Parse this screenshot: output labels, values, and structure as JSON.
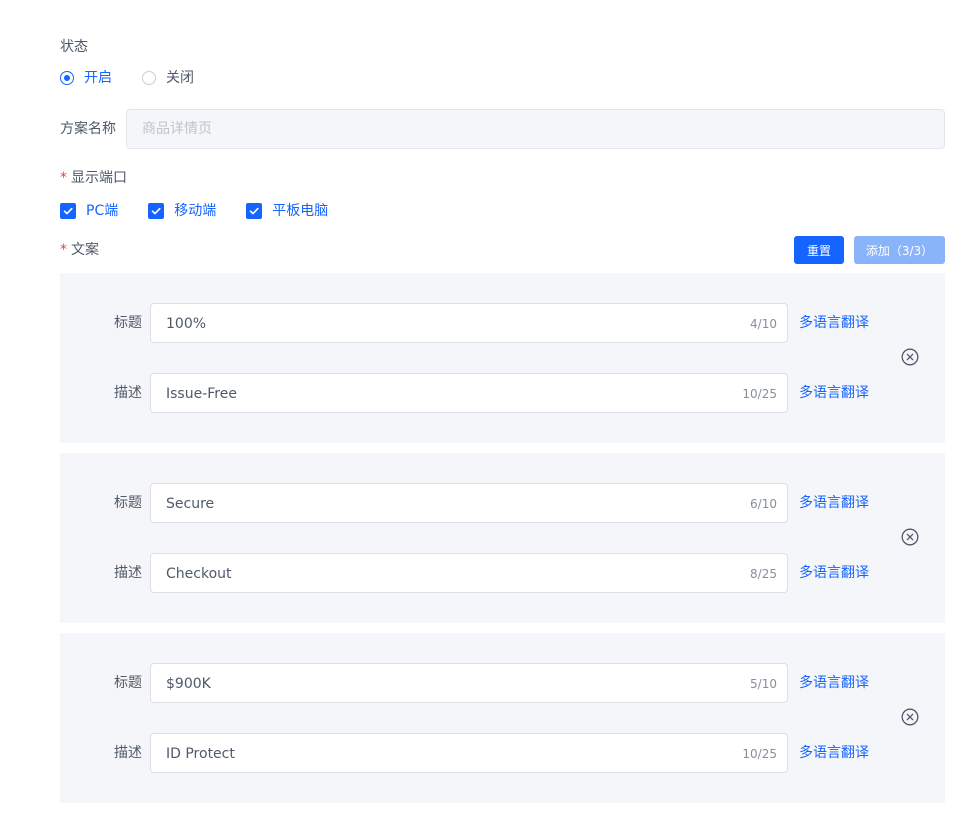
{
  "status": {
    "label": "状态",
    "options": [
      {
        "label": "开启",
        "checked": true
      },
      {
        "label": "关闭",
        "checked": false
      }
    ]
  },
  "plan_name": {
    "label": "方案名称",
    "placeholder": "商品详情页"
  },
  "ports": {
    "required_mark": "*",
    "label": "显示端口",
    "options": [
      {
        "label": "PC端",
        "checked": true
      },
      {
        "label": "移动端",
        "checked": true
      },
      {
        "label": "平板电脑",
        "checked": true
      }
    ]
  },
  "copy": {
    "required_mark": "*",
    "label": "文案",
    "reset_label": "重置",
    "add_label": "添加（3/3）",
    "title_label": "标题",
    "desc_label": "描述",
    "translate_label": "多语言翻译",
    "items": [
      {
        "title": "100%",
        "title_count": "4/10",
        "desc": "Issue-Free",
        "desc_count": "10/25"
      },
      {
        "title": "Secure",
        "title_count": "6/10",
        "desc": "Checkout",
        "desc_count": "8/25"
      },
      {
        "title": "$900K",
        "title_count": "5/10",
        "desc": "ID Protect",
        "desc_count": "10/25"
      }
    ]
  },
  "colors": {
    "primary": "#1664ff",
    "primary_disabled": "#8ab4fa",
    "card_bg": "#f5f6f9",
    "required": "#f53f3f"
  }
}
